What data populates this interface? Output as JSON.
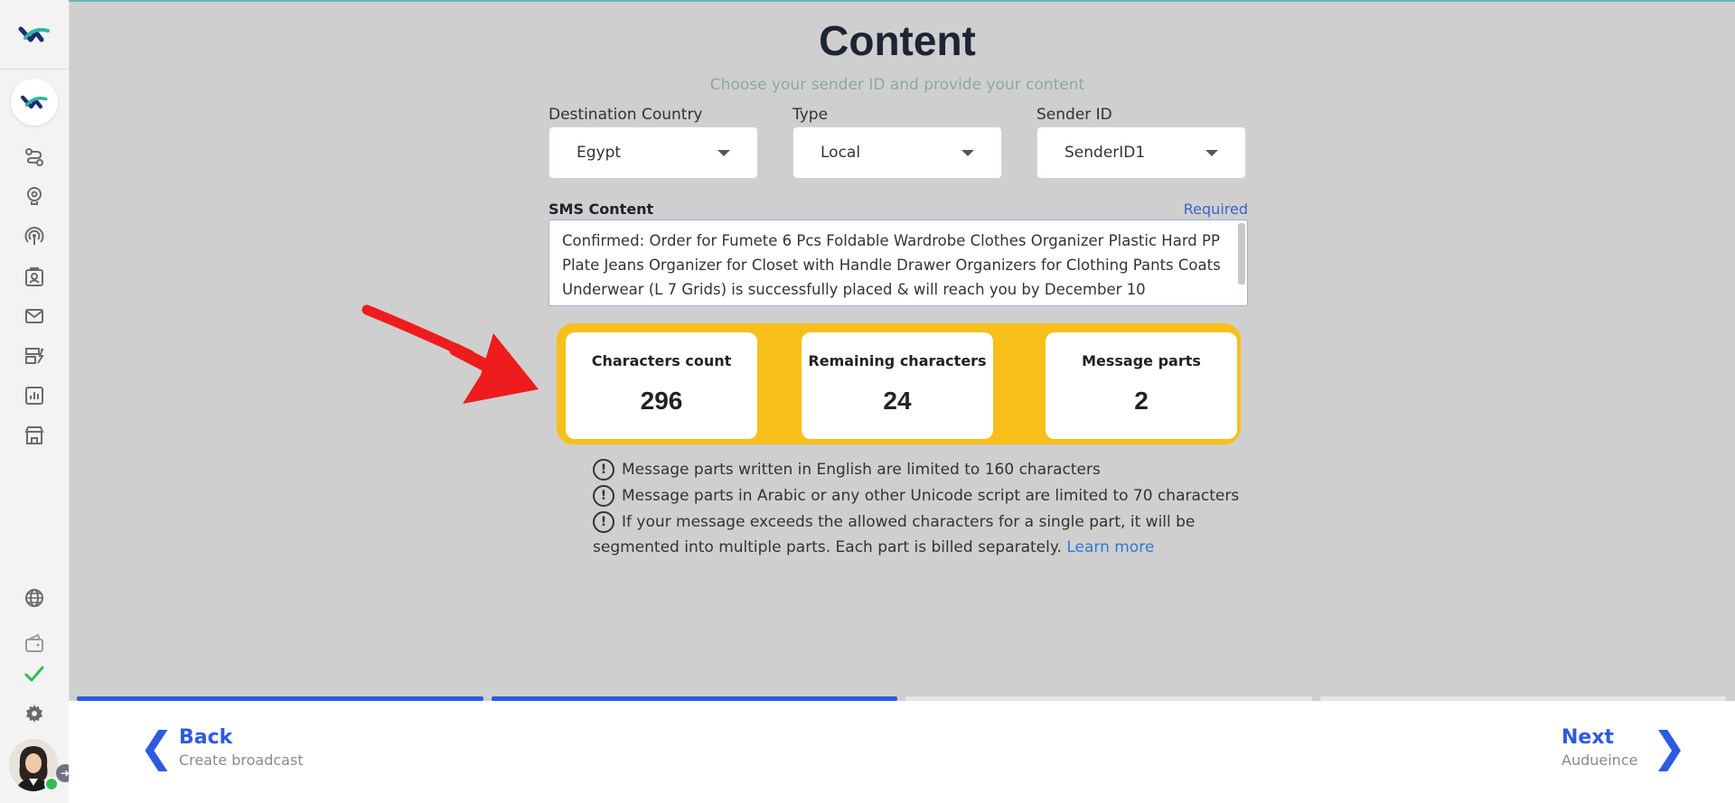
{
  "page": {
    "title": "Content",
    "subtitle": "Choose your sender ID and provide your content"
  },
  "fields": {
    "destination_country": {
      "label": "Destination Country",
      "value": "Egypt"
    },
    "type": {
      "label": "Type",
      "value": "Local"
    },
    "sender_id": {
      "label": "Sender ID",
      "value": "SenderID1"
    }
  },
  "sms": {
    "label": "SMS Content",
    "required": "Required",
    "content": "Confirmed: Order for Fumete 6 Pcs Foldable Wardrobe Clothes Organizer Plastic Hard PP Plate Jeans Organizer for Closet with Handle Drawer Organizers for Clothing Pants Coats Underwear (L 7 Grids)  is successfully placed & will reach you by December 10"
  },
  "stats": {
    "characters_count": {
      "label": "Characters count",
      "value": "296"
    },
    "remaining_characters": {
      "label": "Remaining characters",
      "value": "24"
    },
    "message_parts": {
      "label": "Message parts",
      "value": "2"
    }
  },
  "info": {
    "line1": "Message parts written in English are limited to 160 characters",
    "line2": "Message parts in Arabic or any other Unicode script are limited to 70 characters",
    "line3a": "If your message exceeds the allowed characters for a single part, it will be",
    "line3b": "segmented into multiple parts. Each part is billed separately.",
    "learn_more": "Learn more",
    "icon_glyph": "!"
  },
  "progress": {
    "total_steps": 4,
    "completed_steps": 2,
    "active_color": "#2d5ae0",
    "inactive_color": "#e6e6e6"
  },
  "footer": {
    "back": {
      "label": "Back",
      "sub": "Create broadcast"
    },
    "next": {
      "label": "Next",
      "sub": "Audueince"
    }
  },
  "colors": {
    "accent": "#2d5ae0",
    "highlight": "#f8bf1a",
    "arrow": "#ee1c1c",
    "success": "#2fbf55"
  },
  "sidebar": {
    "icons": [
      "logo-icon",
      "brand-icon",
      "route-icon",
      "bulb-gear-icon",
      "broadcast-icon",
      "contacts-icon",
      "mail-icon",
      "templates-icon",
      "analytics-icon",
      "store-icon",
      "globe-icon",
      "wallet-icon",
      "check-icon",
      "gear-icon",
      "avatar"
    ]
  }
}
